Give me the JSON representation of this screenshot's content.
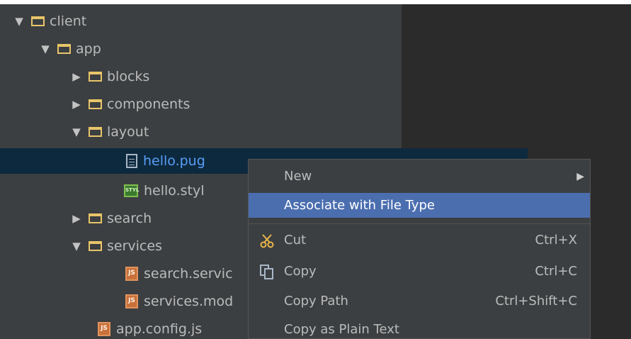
{
  "tree": {
    "items": [
      {
        "label": "client",
        "arrow": "▼",
        "icon": "folder-icon"
      },
      {
        "label": "app",
        "arrow": "▼",
        "icon": "folder-icon"
      },
      {
        "label": "blocks",
        "arrow": "▶",
        "icon": "folder-icon"
      },
      {
        "label": "components",
        "arrow": "▶",
        "icon": "folder-icon"
      },
      {
        "label": "layout",
        "arrow": "▼",
        "icon": "folder-icon"
      },
      {
        "label": "hello.pug",
        "icon": "pug-file-icon",
        "selected": true
      },
      {
        "label": "hello.styl",
        "icon": "stylus-file-icon",
        "badge": "STYL"
      },
      {
        "label": "search",
        "arrow": "▶",
        "icon": "folder-icon"
      },
      {
        "label": "services",
        "arrow": "▼",
        "icon": "folder-icon"
      },
      {
        "label": "search.servic",
        "icon": "js-file-icon",
        "badge": "JS"
      },
      {
        "label": "services.mod",
        "icon": "js-file-icon",
        "badge": "JS"
      },
      {
        "label": "app.config.js",
        "icon": "js-file-icon",
        "badge": "JS"
      }
    ]
  },
  "context_menu": {
    "items": [
      {
        "label": "New",
        "submenu_arrow": "▶"
      },
      {
        "label": "Associate with File Type",
        "highlighted": true
      },
      {
        "label": "Cut",
        "shortcut": "Ctrl+X",
        "icon": "scissors-icon"
      },
      {
        "label": "Copy",
        "shortcut": "Ctrl+C",
        "icon": "copy-icon"
      },
      {
        "label": "Copy Path",
        "shortcut": "Ctrl+Shift+C"
      },
      {
        "label": "Copy as Plain Text"
      }
    ]
  },
  "colors": {
    "tree_bg": "#3c3f41",
    "selection_bg": "#0d293e",
    "selection_text": "#589df6",
    "menu_highlight": "#4b6eaf",
    "folder": "#e8c56a"
  }
}
